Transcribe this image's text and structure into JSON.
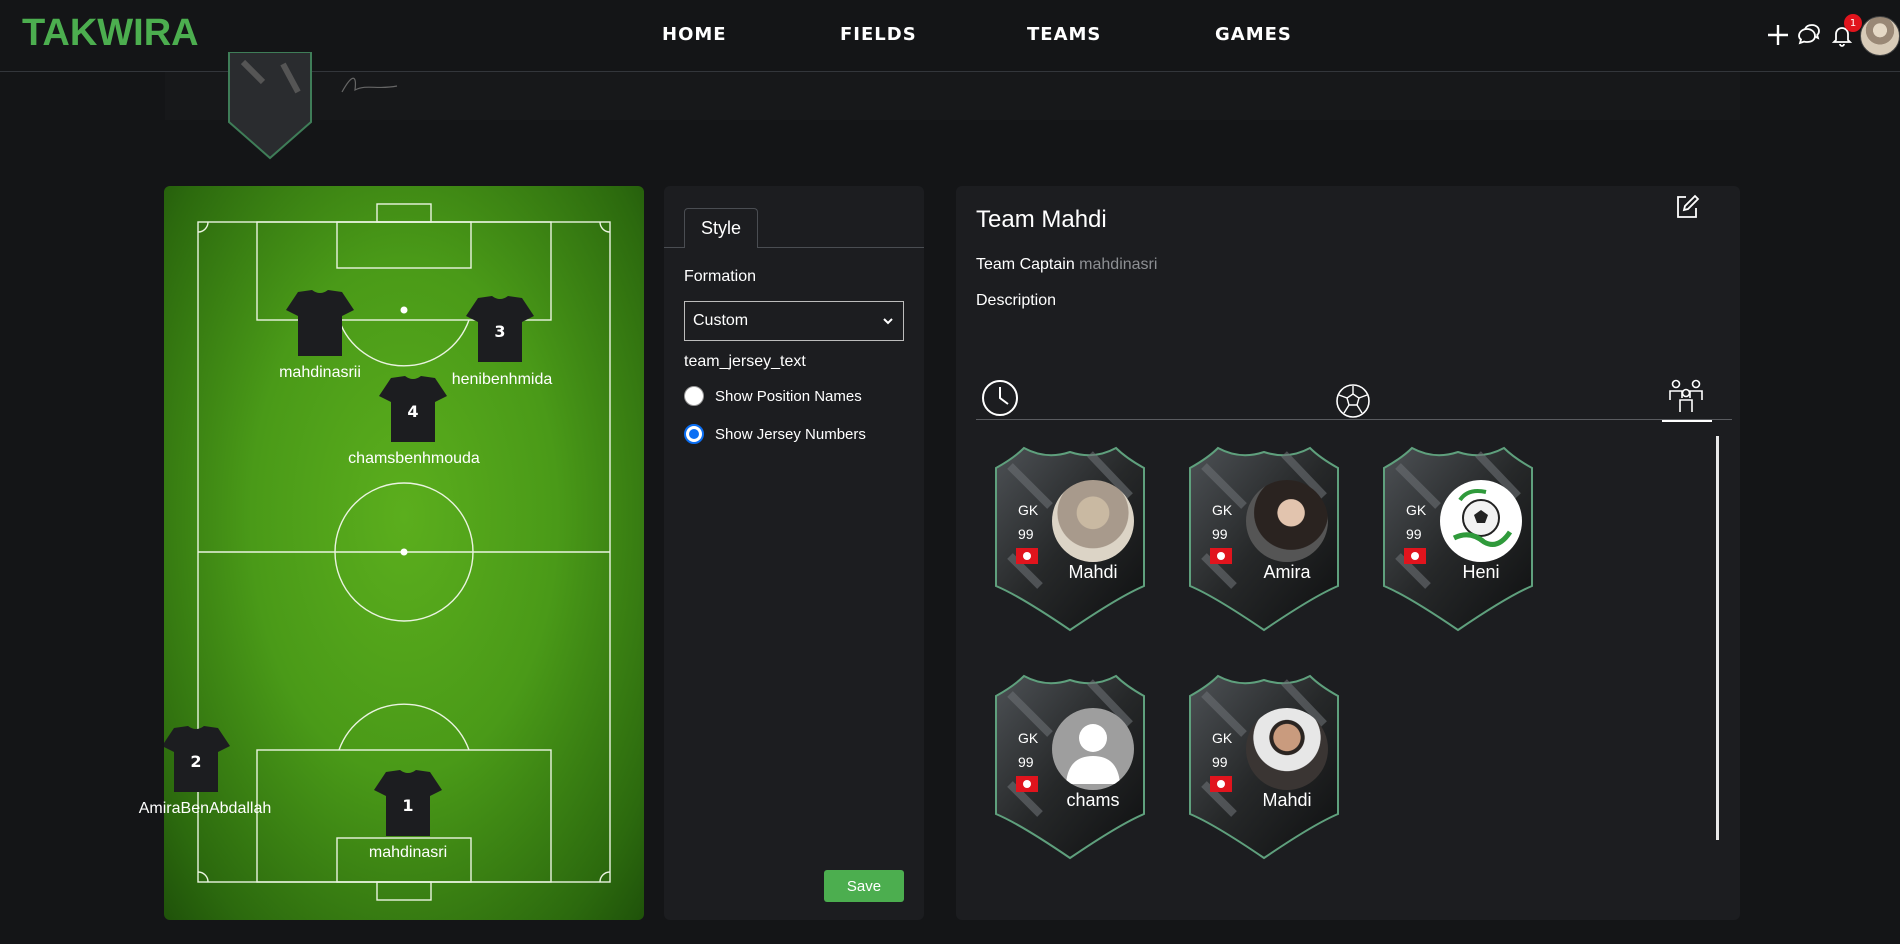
{
  "brand": {
    "name": "TAKWIRA",
    "accent": "#4cae4f"
  },
  "nav": {
    "links": [
      "HOME",
      "FIELDS",
      "TEAMS",
      "GAMES"
    ]
  },
  "header_icons": {
    "add": "plus-icon",
    "chat": "chat-bubbles-icon",
    "notifications": "bell-icon",
    "notification_count": "1"
  },
  "pitch": {
    "players": [
      {
        "number": "",
        "name": "mahdinasrii"
      },
      {
        "number": "3",
        "name": "henibenhmida"
      },
      {
        "number": "4",
        "name": "chamsbenhmouda"
      },
      {
        "number": "2",
        "name": "AmiraBenAbdallah"
      },
      {
        "number": "1",
        "name": "mahdinasri"
      }
    ]
  },
  "style_panel": {
    "tab_label": "Style",
    "formation_label": "Formation",
    "formation_value": "Custom",
    "jersey_text_label": "team_jersey_text",
    "options": [
      {
        "label": "Show Position Names",
        "checked": false
      },
      {
        "label": "Show Jersey Numbers",
        "checked": true
      }
    ],
    "save_label": "Save"
  },
  "team": {
    "name": "Team Mahdi",
    "captain_label": "Team Captain",
    "captain_value": "mahdinasri",
    "description_label": "Description",
    "tabs": [
      "history-clock-icon",
      "soccer-ball-icon",
      "team-members-icon"
    ],
    "cards": [
      {
        "position": "GK",
        "rating": "99",
        "name": "Mahdi",
        "flag": "tunisia"
      },
      {
        "position": "GK",
        "rating": "99",
        "name": "Amira",
        "flag": "tunisia"
      },
      {
        "position": "GK",
        "rating": "99",
        "name": "Heni",
        "flag": "tunisia"
      },
      {
        "position": "GK",
        "rating": "99",
        "name": "chams",
        "flag": "tunisia"
      },
      {
        "position": "GK",
        "rating": "99",
        "name": "Mahdi",
        "flag": "tunisia"
      }
    ]
  }
}
